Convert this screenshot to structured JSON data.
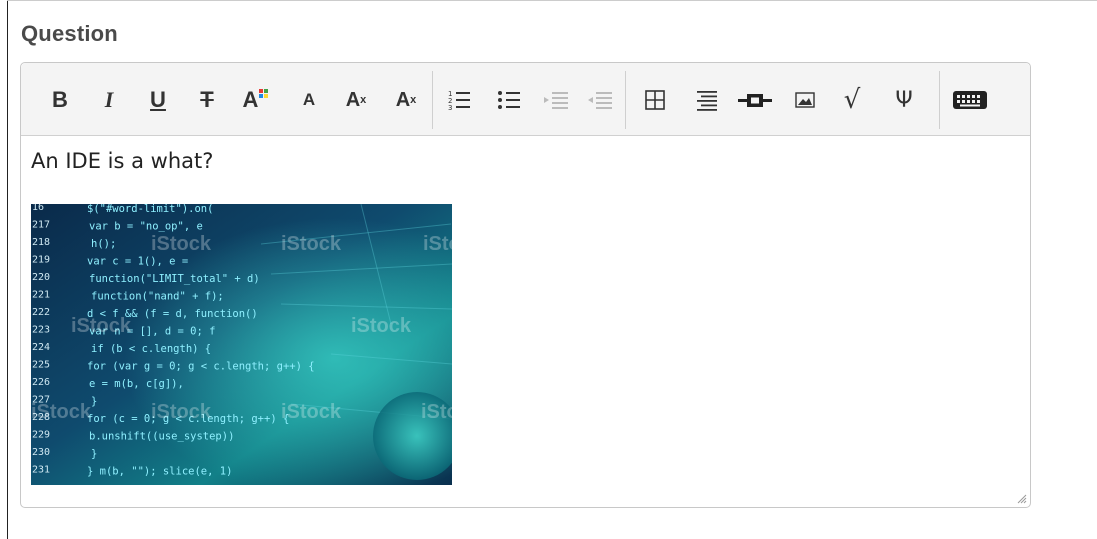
{
  "question": {
    "label": "Question"
  },
  "editor": {
    "body_text": "An IDE is a what?",
    "toolbar": {
      "bold": "B",
      "italic": "I",
      "underline": "U",
      "strike": "T",
      "color": "A",
      "font_size_small": "A",
      "superscript_base": "A",
      "superscript_mark": "x",
      "subscript_base": "A",
      "subscript_mark": "x",
      "math": "√",
      "symbol": "Ψ"
    },
    "image": {
      "line_numbers": [
        "16",
        "217",
        "218",
        "219",
        "220",
        "221",
        "222",
        "223",
        "224",
        "225",
        "226",
        "227",
        "228",
        "229",
        "230",
        "231"
      ],
      "code_lines": [
        "$(\"#word-limit\").on(",
        "var b = \"no_op\", e",
        "h();",
        "var c = 1(), e = ",
        "function(\"LIMIT_total\" + d)",
        "function(\"nand\" + f);",
        "d < f && (f = d, function()",
        "var n = [], d = 0; f",
        "if (b < c.length) {",
        "  for (var g = 0; g < c.length; g++) {",
        "    e = m(b, c[g]),",
        "  }",
        "  for (c = 0; g < c.length; g++) {",
        "    b.unshift((use_systep))",
        "  }",
        "}  m(b, \"\"); slice(e, 1)"
      ],
      "watermark": "iStock"
    }
  }
}
